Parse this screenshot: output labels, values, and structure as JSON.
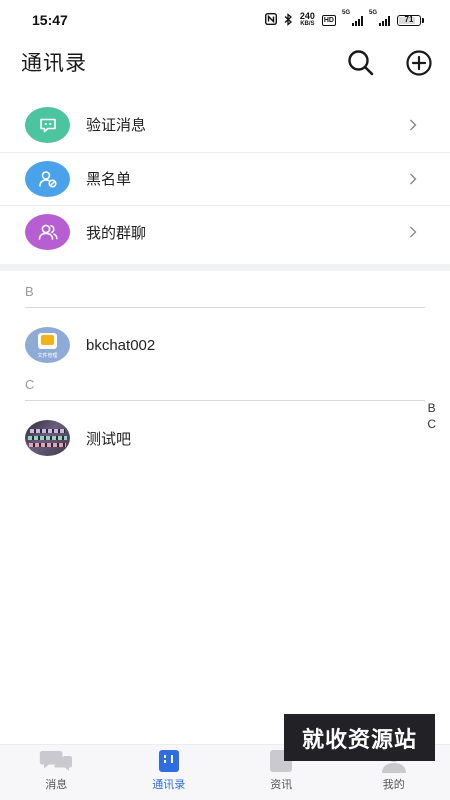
{
  "status_bar": {
    "time": "15:47",
    "net_speed_value": "240",
    "net_speed_unit": "KB/S",
    "hd_label": "HD",
    "signal1_label": "5G",
    "signal2_label": "5G",
    "battery_level": "71"
  },
  "header": {
    "title": "通讯录",
    "search_icon": "search-icon",
    "add_icon": "add-circle-icon"
  },
  "menu": {
    "items": [
      {
        "label": "验证消息",
        "icon": "chat-dots-icon",
        "color": "#4cc59e"
      },
      {
        "label": "黑名单",
        "icon": "user-block-icon",
        "color": "#4aa3ea"
      },
      {
        "label": "我的群聊",
        "icon": "group-icon",
        "color": "#b85ed3"
      }
    ]
  },
  "contacts": {
    "sections": [
      {
        "letter": "B",
        "contacts": [
          {
            "name": "bkchat002",
            "avatar_text": "文件管理"
          }
        ]
      },
      {
        "letter": "C",
        "contacts": [
          {
            "name": "测试吧"
          }
        ]
      }
    ]
  },
  "alpha_index": [
    "B",
    "C"
  ],
  "watermark": "就收资源站",
  "bottom_nav": {
    "items": [
      {
        "label": "消息",
        "icon": "message-icon"
      },
      {
        "label": "通讯录",
        "icon": "contacts-icon"
      },
      {
        "label": "资讯",
        "icon": "news-icon"
      },
      {
        "label": "我的",
        "icon": "profile-icon"
      }
    ],
    "active_index": 1,
    "active_color": "#2f6de2"
  }
}
